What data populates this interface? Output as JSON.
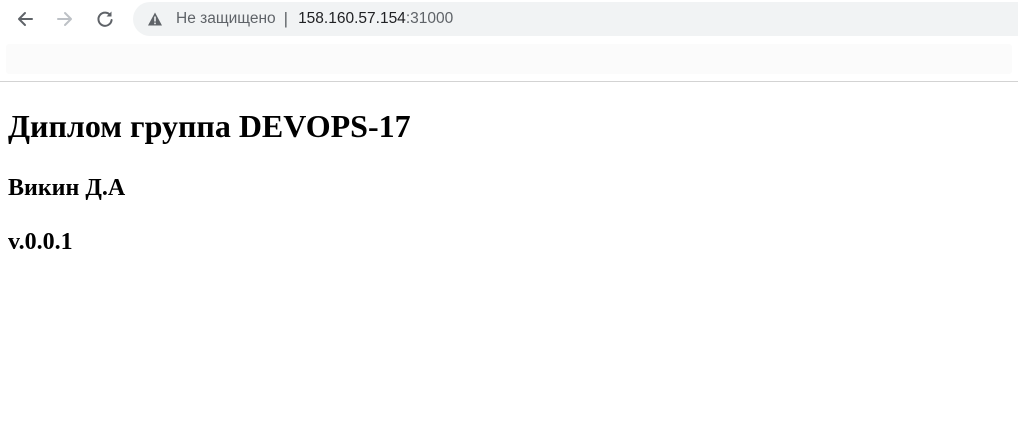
{
  "browser": {
    "security_label": "Не защищено",
    "separator": "|",
    "url_host": "158.160.57.154",
    "url_port": ":31000",
    "icons": {
      "back": "arrow-left-icon",
      "forward": "arrow-right-icon",
      "reload": "reload-icon",
      "security": "warning-triangle-icon"
    }
  },
  "page": {
    "title": "Диплом группа DEVOPS-17",
    "author": "Викин Д.А",
    "version": "v.0.0.1"
  }
}
